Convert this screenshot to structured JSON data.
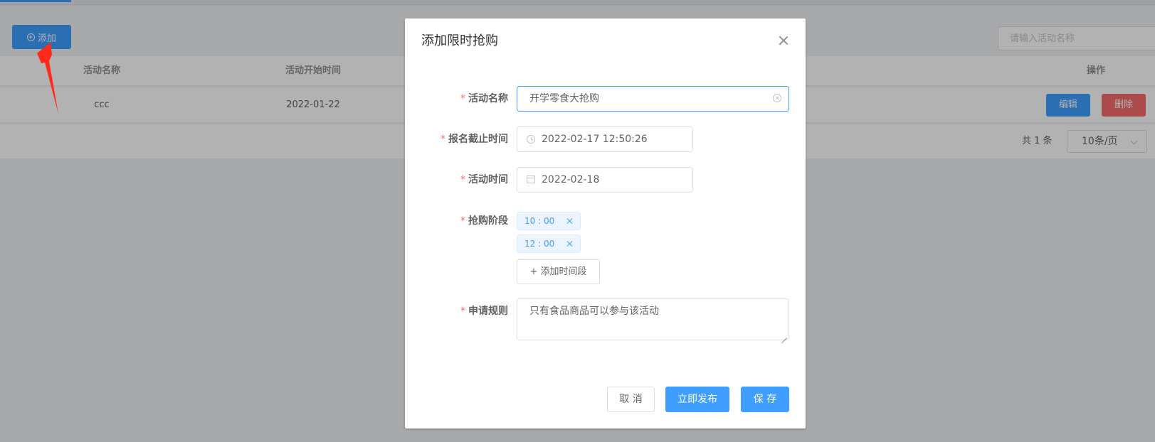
{
  "toolbar": {
    "add_label": "添加",
    "search_placeholder": "请输入活动名称"
  },
  "table": {
    "columns": [
      "活动名称",
      "活动开始时间",
      "操作"
    ],
    "rows": [
      {
        "name": "ccc",
        "start_time": "2022-01-22"
      }
    ],
    "edit_label": "编辑",
    "delete_label": "删除"
  },
  "pagination": {
    "total_text": "共 1 条",
    "page_size": "10条/页"
  },
  "dialog": {
    "title": "添加限时抢购",
    "required_mark": "*",
    "fields": {
      "name": {
        "label": "活动名称",
        "value": "开学零食大抢购"
      },
      "deadline": {
        "label": "报名截止时间",
        "value": "2022-02-17 12:50:26"
      },
      "date": {
        "label": "活动时间",
        "value": "2022-02-18"
      },
      "periods": {
        "label": "抢购阶段",
        "tags": [
          "10 : 00",
          "12 : 00"
        ],
        "add_label": "+ 添加时间段"
      },
      "rules": {
        "label": "申请规则",
        "value": "只有食品商品可以参与该活动"
      }
    },
    "buttons": {
      "cancel": "取 消",
      "publish": "立即发布",
      "save": "保 存"
    }
  },
  "colors": {
    "primary": "#409eff",
    "danger": "#f56c6c",
    "annotation_arrow": "#ff2a1a"
  },
  "icons": [
    "plus-circle-icon",
    "close-icon",
    "clear-icon",
    "clock-icon",
    "calendar-icon",
    "tag-close-icon",
    "resize-icon",
    "chevron-down-icon",
    "annotation-arrow-icon"
  ]
}
